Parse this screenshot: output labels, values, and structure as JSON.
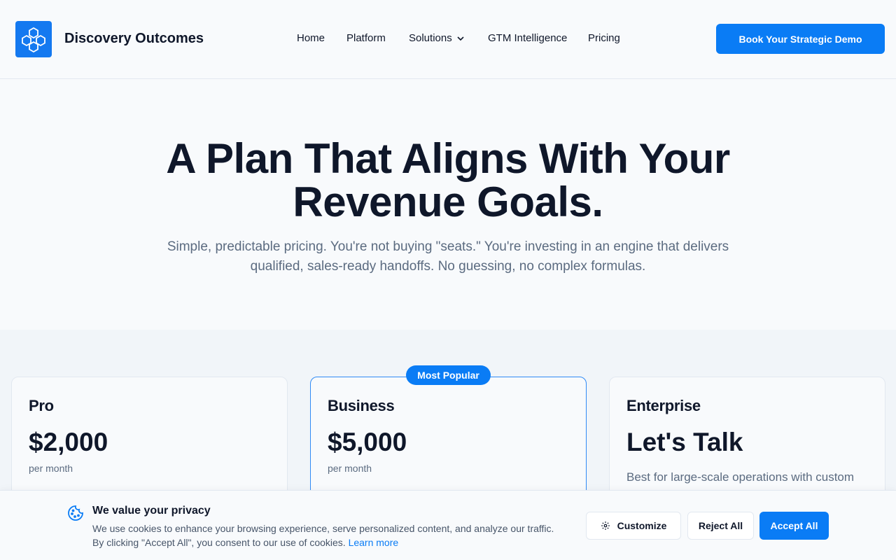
{
  "header": {
    "brand": "Discovery Outcomes",
    "logo_icon": "hexagon-network-icon",
    "nav": [
      {
        "label": "Home"
      },
      {
        "label": "Platform"
      },
      {
        "label": "Solutions",
        "has_dropdown": true
      },
      {
        "label": "GTM Intelligence"
      },
      {
        "label": "Pricing"
      }
    ],
    "cta_label": "Book Your Strategic Demo"
  },
  "hero": {
    "title_line1": "A Plan That Aligns With Your",
    "title_line2": "Revenue Goals.",
    "subtitle_line1": "Simple, predictable pricing. You're not buying \"seats.\" You're investing in an engine that delivers",
    "subtitle_line2": "qualified, sales-ready handoffs. No guessing, no complex formulas."
  },
  "plans": [
    {
      "name": "Pro",
      "price": "$2,000",
      "period": "per month"
    },
    {
      "name": "Business",
      "price": "$5,000",
      "period": "per month",
      "badge": "Most Popular"
    },
    {
      "name": "Enterprise",
      "price": "Let's Talk",
      "description": "Best for large-scale operations with custom"
    }
  ],
  "cookie": {
    "icon": "cookie-icon",
    "title": "We value your privacy",
    "text_line1": "We use cookies to enhance your browsing experience, serve personalized content, and analyze our traffic.",
    "text_line2": "By clicking \"Accept All\", you consent to our use of cookies.",
    "link": "Learn more",
    "customize_label": "Customize",
    "reject_label": "Reject All",
    "accept_label": "Accept All"
  },
  "colors": {
    "accent": "#0a7cf5",
    "text": "#0f172a",
    "muted": "#5b6b80",
    "border": "#e2e8f0"
  }
}
